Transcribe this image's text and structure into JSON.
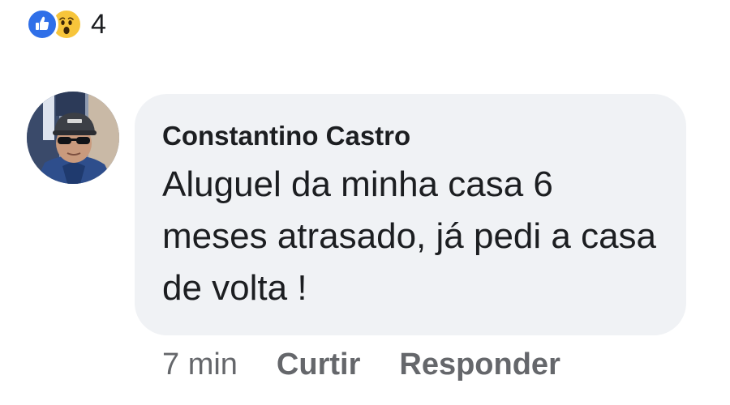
{
  "reactions": {
    "types": [
      "like-icon",
      "wow-icon"
    ],
    "count": "4",
    "colors": {
      "like": "#2f6fe8",
      "wow": "#f7c53b"
    }
  },
  "comment": {
    "author": "Constantino Castro",
    "text": "Aluguel da minha casa 6 meses atrasado, já pedi a casa de volta !",
    "bubble_color": "#f0f2f5"
  },
  "actions": {
    "time": "7 min",
    "like_label": "Curtir",
    "reply_label": "Responder"
  }
}
